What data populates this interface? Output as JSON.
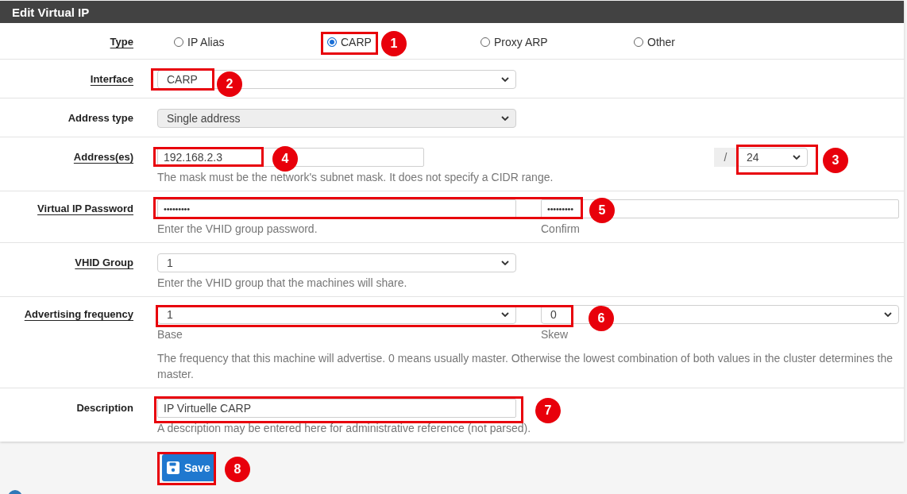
{
  "panel": {
    "title": "Edit Virtual IP"
  },
  "rows": [
    {
      "kind": "radios",
      "label": "Type",
      "required": true,
      "options": [
        {
          "label": "IP Alias",
          "selected": false
        },
        {
          "label": "CARP",
          "selected": true
        },
        {
          "label": "Proxy ARP",
          "selected": false
        },
        {
          "label": "Other",
          "selected": false
        }
      ]
    },
    {
      "kind": "select",
      "label": "Interface",
      "required": true,
      "value": "CARP",
      "disabled": false
    },
    {
      "kind": "select",
      "label": "Address type",
      "required": false,
      "value": "Single address",
      "disabled": true
    },
    {
      "kind": "address",
      "label": "Address(es)",
      "required": true,
      "value": "192.168.2.3",
      "separator": "/",
      "mask": "24",
      "help": "The mask must be the network's subnet mask. It does not specify a CIDR range."
    },
    {
      "kind": "pair",
      "label": "Virtual IP Password",
      "required": true,
      "fields": [
        {
          "kind": "password",
          "value": "•••••••••",
          "help": "Enter the VHID group password."
        },
        {
          "kind": "password",
          "value": "•••••••••",
          "help": "Confirm"
        }
      ]
    },
    {
      "kind": "select",
      "label": "VHID Group",
      "required": true,
      "value": "1",
      "disabled": false,
      "help": "Enter the VHID group that the machines will share."
    },
    {
      "kind": "pair",
      "label": "Advertising frequency",
      "required": true,
      "fields": [
        {
          "kind": "select",
          "value": "1",
          "help": "Base"
        },
        {
          "kind": "select",
          "value": "0",
          "help": "Skew"
        }
      ],
      "help": "The frequency that this machine will advertise. 0 means usually master. Otherwise the lowest combination of both values in the cluster determines the master."
    },
    {
      "kind": "input",
      "label": "Description",
      "required": false,
      "value": "IP Virtuelle CARP",
      "help": "A description may be entered here for administrative reference (not parsed)."
    }
  ],
  "save_button": {
    "label": "Save"
  },
  "callouts": [
    "1",
    "2",
    "3",
    "4",
    "5",
    "6",
    "7",
    "8"
  ]
}
